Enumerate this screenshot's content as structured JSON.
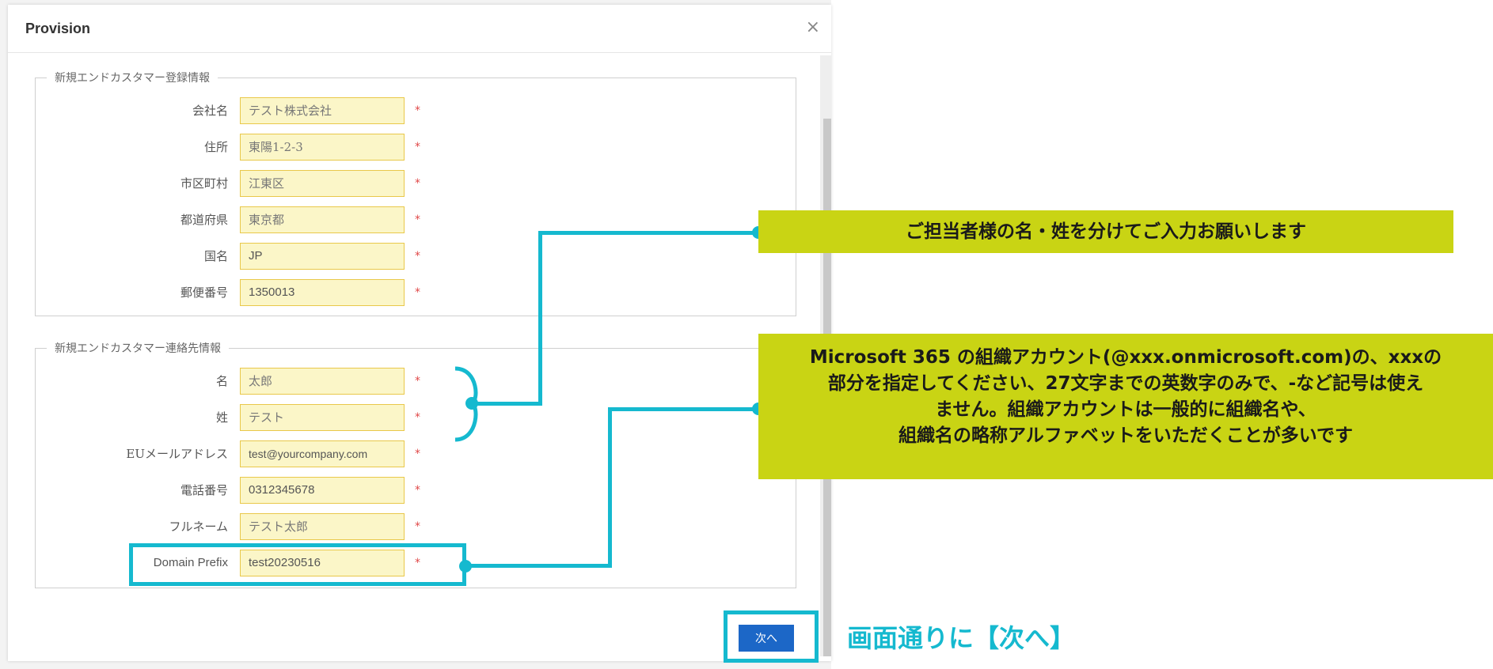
{
  "dialog": {
    "title": "Provision",
    "close_glyph": "×",
    "next_label": "次へ"
  },
  "section_company": {
    "legend": "新規エンドカスタマー登録情報",
    "fields": [
      {
        "label": "会社名",
        "value": "テスト株式会社"
      },
      {
        "label": "住所",
        "value": "東陽1-2-3"
      },
      {
        "label": "市区町村",
        "value": "江東区"
      },
      {
        "label": "都道府県",
        "value": "東京都"
      },
      {
        "label": "国名",
        "value": "JP"
      },
      {
        "label": "郵便番号",
        "value": "1350013"
      }
    ]
  },
  "section_contact": {
    "legend": "新規エンドカスタマー連絡先情報",
    "fields": [
      {
        "label": "名",
        "value": "太郎"
      },
      {
        "label": "姓",
        "value": "テスト"
      },
      {
        "label": "EUメールアドレス",
        "value": "test@yourcompany.com"
      },
      {
        "label": "電話番号",
        "value": "0312345678"
      },
      {
        "label": "フルネーム",
        "value": "テスト太郎"
      },
      {
        "label": "Domain Prefix",
        "value": "test20230516"
      }
    ]
  },
  "required_mark": "*",
  "annotations": {
    "name_note": "ご担当者様の名・姓を分けてご入力お願いします",
    "domain_note_lines": [
      "Microsoft 365 の組織アカウント(@xxx.onmicrosoft.com)の、xxxの",
      "部分を指定してください、27文字までの英数字のみで、-など記号は使え",
      "ません。組織アカウントは一般的に組織名や、",
      "組織名の略称アルファベットをいただくことが多いです"
    ],
    "next_note": "画面通りに【次へ】"
  },
  "colors": {
    "accent_cyan": "#15b9cf",
    "note_green": "#c9d414",
    "input_bg": "#fbf6c8",
    "button_blue": "#1c67c7",
    "required_red": "#e04848"
  }
}
